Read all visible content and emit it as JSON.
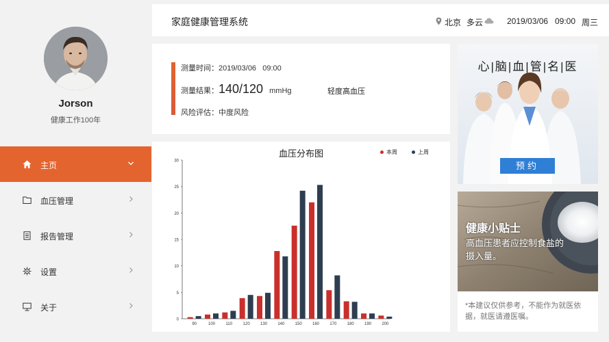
{
  "user": {
    "name": "Jorson",
    "subtitle": "健康工作100年"
  },
  "nav": [
    {
      "label": "主页",
      "icon": "home-icon",
      "active": true
    },
    {
      "label": "血压管理",
      "icon": "folder-icon",
      "active": false
    },
    {
      "label": "报告管理",
      "icon": "document-icon",
      "active": false
    },
    {
      "label": "设置",
      "icon": "gear-icon",
      "active": false
    },
    {
      "label": "关于",
      "icon": "monitor-icon",
      "active": false
    }
  ],
  "header": {
    "title": "家庭健康管理系统",
    "city": "北京",
    "weather": "多云",
    "date": "2019/03/06",
    "time": "09:00",
    "weekday": "周三"
  },
  "measurement": {
    "time_label": "测量时间：",
    "time_value": "2019/03/06   09:00",
    "result_label": "测量结果：",
    "result_value": "140/120",
    "result_unit": "mmHg",
    "result_tag": "轻度高血压",
    "risk_label": "风险评估：",
    "risk_value": "中度风险"
  },
  "chart_data": {
    "type": "bar",
    "title": "血压分布图",
    "categories": [
      "90",
      "100",
      "110",
      "120",
      "130",
      "140",
      "150",
      "160",
      "170",
      "180",
      "190",
      "200"
    ],
    "series": [
      {
        "name": "本周",
        "color": "#c9302c",
        "values": [
          0.3,
          0.8,
          1.2,
          3.9,
          4.3,
          12.8,
          17.6,
          22.0,
          5.4,
          3.3,
          1.0,
          0.6
        ]
      },
      {
        "name": "上周",
        "color": "#2d3e50",
        "values": [
          0.5,
          1.0,
          1.5,
          4.5,
          4.9,
          11.8,
          24.2,
          25.3,
          8.2,
          3.2,
          1.0,
          0.4
        ]
      }
    ],
    "yticks": [
      "0",
      "5",
      "10",
      "15",
      "20",
      "25",
      "30"
    ],
    "ylim": [
      0,
      30
    ],
    "grid": false,
    "legend_position": "top-right"
  },
  "doctors": {
    "title": "心|脑|血|管|名|医",
    "button": "预约"
  },
  "tips": {
    "title": "健康小贴士",
    "text": "高血压患者应控制食盐的摄入量。",
    "note": "*本建议仅供参考，不能作为就医依据，就医请遵医嘱。"
  },
  "colors": {
    "accent": "#e4642f",
    "this_week": "#c9302c",
    "last_week": "#2d3e50",
    "button": "#2f7fd6"
  }
}
